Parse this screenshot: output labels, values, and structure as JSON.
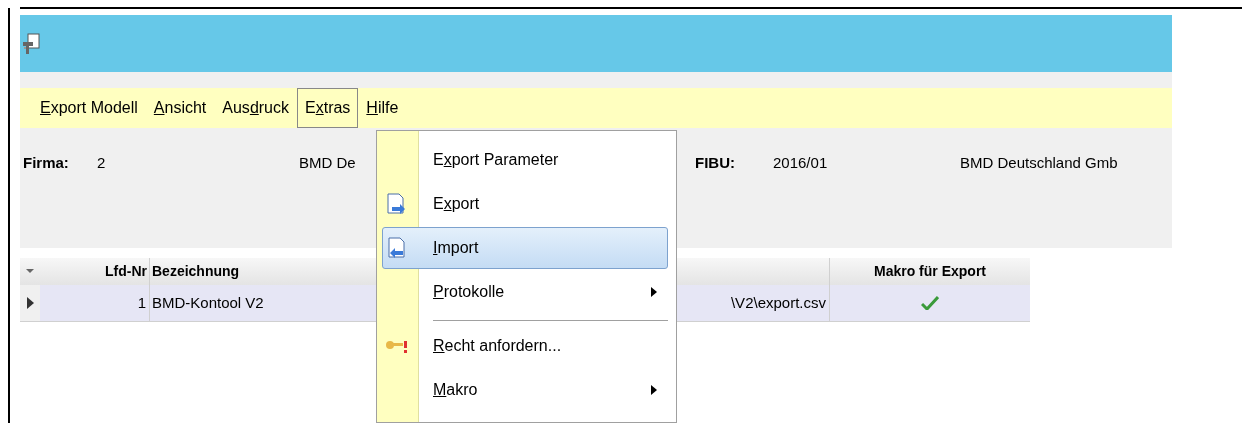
{
  "menu_bar": [
    {
      "access_key": "E",
      "label_after": "xport Modell",
      "selected": false
    },
    {
      "access_key": "A",
      "label_after": "nsicht",
      "selected": false
    },
    {
      "label_before": "Aus",
      "access_key": "d",
      "label_after": "ruck",
      "selected": false
    },
    {
      "label_before": "E",
      "access_key": "x",
      "label_after": "tras",
      "selected": true
    },
    {
      "access_key": "H",
      "label_after": "ilfe",
      "selected": false
    }
  ],
  "header": {
    "firma_label": "Firma:",
    "firma_value": "2",
    "firma_name": "BMD De",
    "fibu_label": "FIBU:",
    "fibu_value": "2016/01",
    "company": "BMD Deutschland Gmb"
  },
  "table": {
    "columns": [
      "Lfd-Nr",
      "Bezeichnung",
      "Makro für Export"
    ],
    "rows": [
      {
        "selected": true,
        "lfd_nr": "1",
        "bezeichnung": "BMD-Kontool V2",
        "column_3": "\\V2\\export.csv",
        "makro_fuer_export": true
      }
    ]
  },
  "extras_menu": [
    {
      "kind": "item",
      "label_before": "E",
      "access_key": "x",
      "label_after": "port Parameter",
      "submenu": false,
      "selected": false
    },
    {
      "kind": "item",
      "label_before": "E",
      "access_key": "x",
      "label_after": "port",
      "submenu": false,
      "selected": false
    },
    {
      "kind": "item",
      "access_key": "I",
      "label_after": "mport",
      "submenu": false,
      "selected": true
    },
    {
      "kind": "item",
      "access_key": "P",
      "label_after": "rotokolle",
      "submenu": true,
      "selected": false
    },
    {
      "kind": "separator"
    },
    {
      "kind": "item",
      "access_key": "R",
      "label_after": "echt anfordern...",
      "submenu": false,
      "selected": false
    },
    {
      "kind": "item",
      "access_key": "M",
      "label_after": "akro",
      "submenu": true,
      "selected": false
    }
  ]
}
